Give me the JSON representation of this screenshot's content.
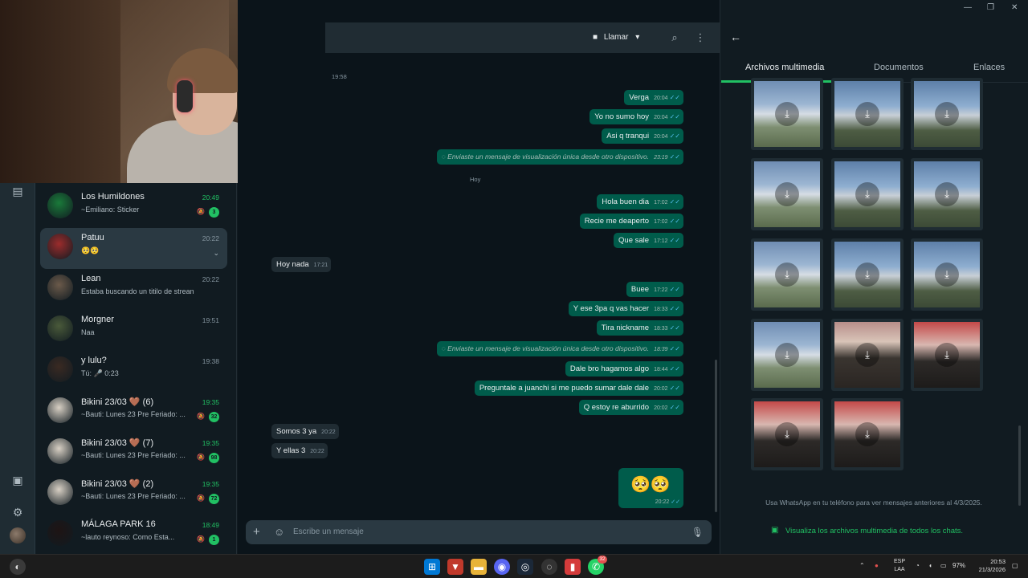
{
  "window": {
    "minimize_icon": "—",
    "maximize_icon": "❐",
    "close_icon": "✕"
  },
  "chat_header": {
    "call_label": "Llamar",
    "call_dropdown_icon": "▾"
  },
  "chat_list": [
    {
      "name": "Los Humildones",
      "time": "20:49",
      "time_green": true,
      "preview": "~Emiliano: Sticker",
      "badge": "3",
      "muted": true
    },
    {
      "name": "Patuu",
      "time": "20:22",
      "time_green": false,
      "preview": "🥺🥺",
      "badge": "",
      "muted": false,
      "selected": true
    },
    {
      "name": "Lean",
      "time": "20:22",
      "time_green": false,
      "preview": "Estaba buscando un titilo de stream",
      "badge": "",
      "muted": false
    },
    {
      "name": "Morgner",
      "time": "19:51",
      "time_green": false,
      "preview": "Naa",
      "badge": "",
      "muted": false
    },
    {
      "name": "y lulu?",
      "time": "19:38",
      "time_green": false,
      "preview": "Tú: 🎤 0:23",
      "badge": "",
      "muted": false
    },
    {
      "name": "Bikini 23/03 🤎 (6)",
      "time": "19:35",
      "time_green": true,
      "preview": "~Bauti: Lunes 23 Pre Feriado: ...",
      "badge": "32",
      "muted": true
    },
    {
      "name": "Bikini 23/03 🤎 (7)",
      "time": "19:35",
      "time_green": true,
      "preview": "~Bauti: Lunes 23 Pre Feriado: ...",
      "badge": "98",
      "muted": true
    },
    {
      "name": "Bikini 23/03 🤎 (2)",
      "time": "19:35",
      "time_green": true,
      "preview": "~Bauti: Lunes 23 Pre Feriado: ...",
      "badge": "72",
      "muted": true
    },
    {
      "name": "MÁLAGA PARK 16",
      "time": "18:49",
      "time_green": true,
      "preview": "~lauto reynoso: Como Esta...",
      "badge": "1",
      "muted": true
    }
  ],
  "messages": {
    "top_time": "19:58",
    "day_label": "Hoy",
    "items": [
      {
        "text": "Verga",
        "time": "20:04",
        "dir": "out"
      },
      {
        "text": "Yo no sumo hoy",
        "time": "20:04",
        "dir": "out"
      },
      {
        "text": "Asi q tranqui",
        "time": "20:04",
        "dir": "out"
      },
      {
        "text": "Enviaste un mensaje de visualización única desde otro dispositivo.",
        "time": "23:19",
        "dir": "sys"
      },
      {
        "text": "Hola buen dia",
        "time": "17:02",
        "dir": "out"
      },
      {
        "text": "Recie me deaperto",
        "time": "17:02",
        "dir": "out"
      },
      {
        "text": "Que sale",
        "time": "17:12",
        "dir": "out"
      },
      {
        "text": "Hoy nada",
        "time": "17:21",
        "dir": "in"
      },
      {
        "text": "Buee",
        "time": "17:22",
        "dir": "out"
      },
      {
        "text": "Y ese 3pa q vas hacer",
        "time": "18:33",
        "dir": "out"
      },
      {
        "text": "Tira nickname",
        "time": "18:33",
        "dir": "out"
      },
      {
        "text": "Enviaste un mensaje de visualización única desde otro dispositivo.",
        "time": "18:39",
        "dir": "sys"
      },
      {
        "text": "Dale bro hagamos algo",
        "time": "18:44",
        "dir": "out"
      },
      {
        "text": "Preguntale a juanchi si me puedo sumar dale dale",
        "time": "20:02",
        "dir": "out"
      },
      {
        "text": "Q estoy re aburrido",
        "time": "20:02",
        "dir": "out"
      },
      {
        "text": "Somos 3 ya",
        "time": "20:22",
        "dir": "in"
      },
      {
        "text": "Y ellas 3",
        "time": "20:22",
        "dir": "in"
      }
    ],
    "emoji_message": {
      "text": "🥺🥺",
      "time": "20:22"
    }
  },
  "composer": {
    "placeholder": "Escribe un mensaje"
  },
  "media_panel": {
    "tabs": [
      "Archivos multimedia",
      "Documentos",
      "Enlaces"
    ],
    "active_tab": 0,
    "note": "Usa WhatsApp en tu teléfono para ver mensajes anteriores al 4/3/2025.",
    "view_all_link": "Visualiza los archivos multimedia de todos los chats.",
    "thumbnail_count": 14
  },
  "taskbar": {
    "whatsapp_badge": "32",
    "lang_top": "ESP",
    "lang_bottom": "LAA",
    "battery": "97%",
    "time": "20:53",
    "date": "21/3/2026"
  },
  "colors": {
    "accent_green": "#21c063",
    "outgoing_bubble": "#005c4b",
    "incoming_bubble": "#202c33",
    "read_check": "#53bdeb"
  }
}
